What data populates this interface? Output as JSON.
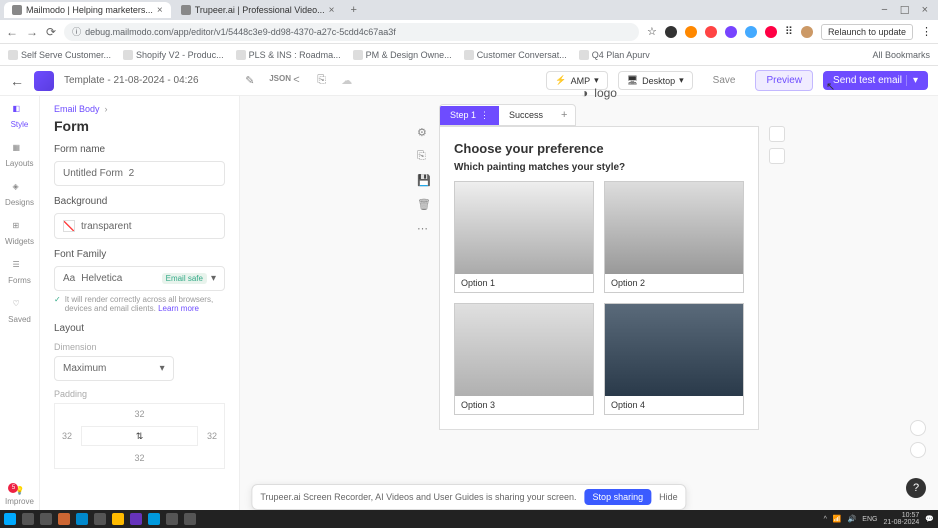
{
  "browser": {
    "tabs": [
      {
        "title": "Mailmodo | Helping marketers..."
      },
      {
        "title": "Trupeer.ai | Professional Video..."
      }
    ],
    "url": "debug.mailmodo.com/app/editor/v1/5448c3e9-dd98-4370-a27c-5cdd4c67aa3f",
    "relaunch": "Relaunch to update",
    "bookmarks": [
      "Self Serve Customer...",
      "Shopify V2 - Produc...",
      "PLS & INS : Roadma...",
      "PM & Design Owne...",
      "Customer Conversat...",
      "Q4 Plan Apurv"
    ],
    "all_bookmarks": "All Bookmarks"
  },
  "header": {
    "template_name": "Template - 21-08-2024 - 04:26",
    "amp": "AMP",
    "desktop": "Desktop",
    "save": "Save",
    "preview": "Preview",
    "send": "Send test email"
  },
  "rail": {
    "items": [
      "Style",
      "Layouts",
      "Designs",
      "Widgets",
      "Forms",
      "Saved"
    ],
    "improve": "Improve",
    "improve_badge": "5"
  },
  "panel": {
    "breadcrumb_parent": "Email Body",
    "title": "Form",
    "form_name_label": "Form name",
    "form_name_value": "Untitled Form  2",
    "background_label": "Background",
    "background_value": "transparent",
    "font_label": "Font Family",
    "font_value": "Helvetica",
    "font_badge": "Email safe",
    "font_help": "It will render correctly across all browsers, devices and email clients.",
    "font_help_link": "Learn more",
    "layout_label": "Layout",
    "dimension_label": "Dimension",
    "dimension_value": "Maximum",
    "padding_label": "Padding",
    "padding": {
      "top": "32",
      "right": "32",
      "bottom": "32",
      "left": "32"
    }
  },
  "canvas": {
    "logo_text": "logo",
    "step_tabs": [
      "Step 1",
      "Success"
    ],
    "heading": "Choose your preference",
    "question": "Which painting matches your style?",
    "options": [
      "Option 1",
      "Option 2",
      "Option 3",
      "Option 4"
    ]
  },
  "recorder": {
    "text": "Trupeer.ai Screen Recorder, AI Videos and User Guides is sharing your screen.",
    "stop": "Stop sharing",
    "hide": "Hide"
  },
  "taskbar": {
    "time": "10:57",
    "date": "21-08-2024",
    "lang": "ENG"
  }
}
